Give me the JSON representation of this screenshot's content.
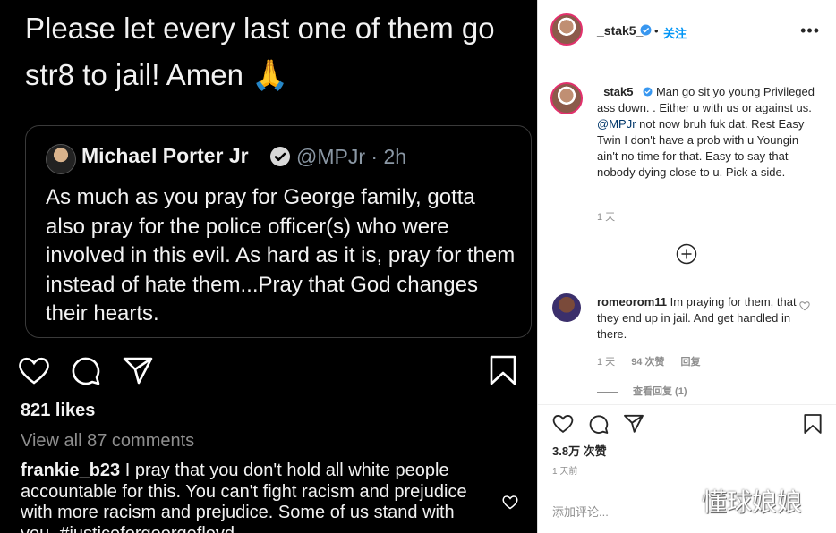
{
  "left_post": {
    "big_text": "Please let every last one of them go str8 to jail! Amen 🙏",
    "quoted_tweet": {
      "name": "Michael Porter Jr",
      "handle": "@MPJr · 2h",
      "body": "As much as you pray for George family, gotta also pray for the police officer(s) who were involved in this evil. As hard as it is, pray for them instead of hate them...Pray that God changes their hearts."
    },
    "likes": "821 likes",
    "view_all": "View all 87 comments",
    "comment": {
      "username": "frankie_b23",
      "text": " I pray that you don't hold all white people accountable for this. You can't fight racism and prejudice with more racism and prejudice. Some of us stand with you. #justiceforgeorgefloyd"
    }
  },
  "right_panel": {
    "header": {
      "username": "_stak5_",
      "dot": "•",
      "follow": "关注",
      "more": "•••"
    },
    "caption": {
      "username": "_stak5_",
      "text_before": " Man go sit yo young Privileged ass down. . Either u with us or against us. ",
      "mention": "@MPJr",
      "text_after": " not now bruh fuk dat. Rest Easy Twin I don't have a prob with u Youngin ain't no time for that. Easy to say that nobody dying close to u. Pick a side.",
      "time": "1 天"
    },
    "comment": {
      "username": "romeorom11",
      "text": " Im praying for them, that they end up in jail. And get handled in there.",
      "time": "1 天",
      "likes": "94 次赞",
      "reply": "回复",
      "view_replies": "查看回复 (1)"
    },
    "likes": "3.8万 次赞",
    "time": "1 天前",
    "add_comment_placeholder": "添加评论..."
  },
  "watermark": "懂球娘娘",
  "colors": {
    "accent_blue": "#0095f6",
    "verified": "#3897f0"
  }
}
